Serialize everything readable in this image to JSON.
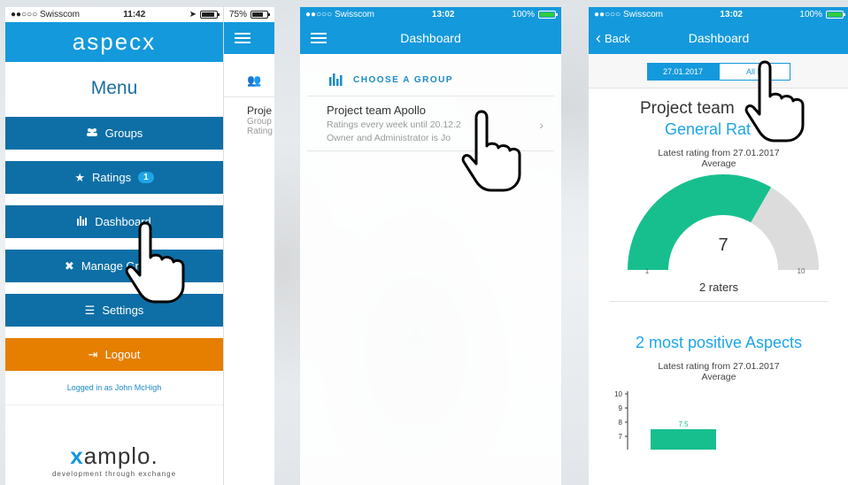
{
  "screen1": {
    "status": {
      "carrier": "●●○○○ Swisscom",
      "time": "11:42",
      "battery": ""
    },
    "logo": "aspecx",
    "menu_title": "Menu",
    "items": [
      {
        "icon": "groups-icon",
        "label": "Groups"
      },
      {
        "icon": "star-icon",
        "label": "Ratings",
        "badge": "1"
      },
      {
        "icon": "dashboard-icon",
        "label": "Dashboard"
      },
      {
        "icon": "tools-icon",
        "label": "Manage Groups"
      },
      {
        "icon": "sliders-icon",
        "label": "Settings"
      }
    ],
    "logout": "Logout",
    "logged_in": "Logged in as John McHigh",
    "brand": "amplo.",
    "brand_x": "x",
    "tagline": "development through exchange"
  },
  "screen1b": {
    "battery": "75%",
    "row_title": "Proje",
    "row_sub1": "Group",
    "row_sub2": "Rating"
  },
  "screen2": {
    "status": {
      "carrier": "●●○○○ Swisscom",
      "time": "13:02",
      "battery": "100%"
    },
    "title": "Dashboard",
    "section": "CHOOSE A GROUP",
    "group": {
      "title": "Project team Apollo",
      "line1": "Ratings every week until 20.12.2",
      "line2": "Owner and Administrator is Jo"
    }
  },
  "screen3": {
    "status": {
      "carrier": "●●○○○ Swisscom",
      "time": "13:02",
      "battery": "100%"
    },
    "back": "Back",
    "title": "Dashboard",
    "seg": [
      "27.01.2017",
      "All R"
    ],
    "project": "Project team",
    "general": "General Rat",
    "latest": "Latest rating from 27.01.2017",
    "average": "Average",
    "gauge": {
      "value": "7",
      "min": "1",
      "max": "10",
      "fraction": 0.667
    },
    "raters": "2 raters",
    "positive": "2 most positive Aspects",
    "latest2": "Latest rating from 27.01.2017",
    "average2": "Average",
    "bar": {
      "label": "7.5",
      "ticks": [
        "10",
        "9",
        "8",
        "7"
      ]
    }
  },
  "colors": {
    "blue": "#1499dc",
    "dark_blue": "#0d6fa6",
    "orange": "#e67e00",
    "teal": "#17bf8f"
  }
}
